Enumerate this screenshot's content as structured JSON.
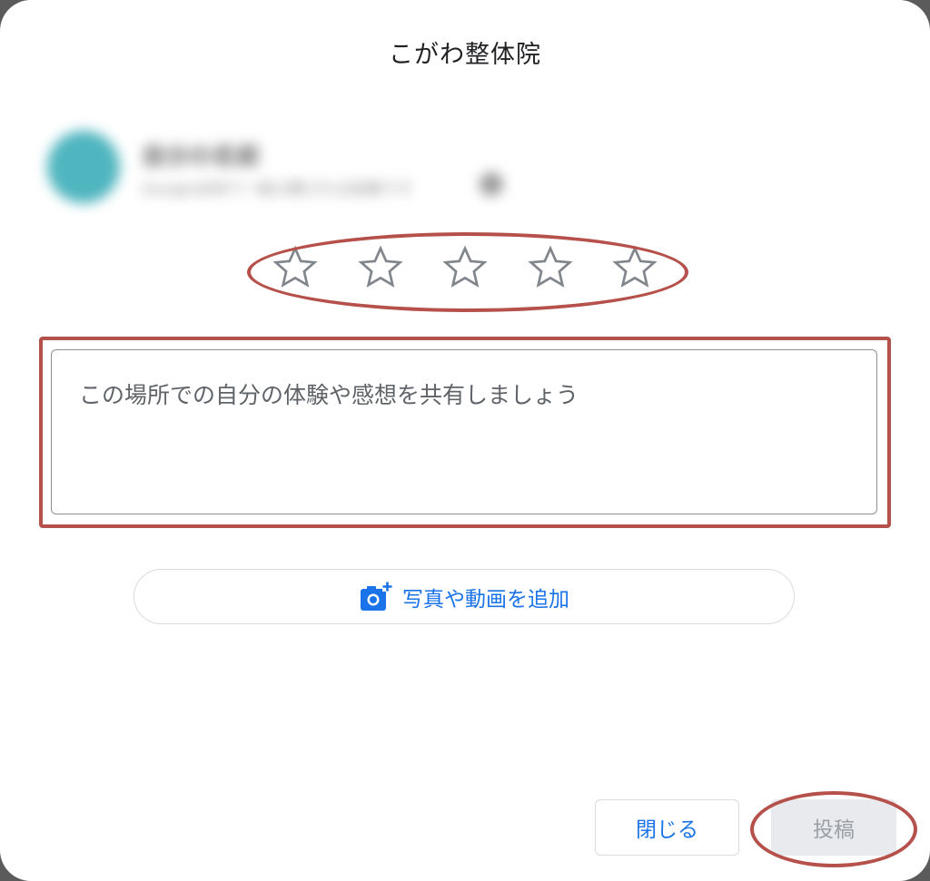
{
  "dialog": {
    "title": "こがわ整体院"
  },
  "user": {
    "name": "自分の名前",
    "subtitle": "Google全体で一般公開される投稿です"
  },
  "rating": {
    "stars": [
      "1",
      "2",
      "3",
      "4",
      "5"
    ],
    "selected": 0,
    "star_color": "#80868b"
  },
  "review": {
    "placeholder": "この場所での自分の体験や感想を共有しましょう",
    "value": ""
  },
  "media": {
    "add_label": "写真や動画を追加",
    "icon": "add-photo-icon"
  },
  "footer": {
    "close_label": "閉じる",
    "post_label": "投稿"
  },
  "colors": {
    "accent": "#1a73e8",
    "annotation": "#b5504a",
    "disabled_bg": "#e8eaed",
    "disabled_text": "#9aa0a6"
  }
}
